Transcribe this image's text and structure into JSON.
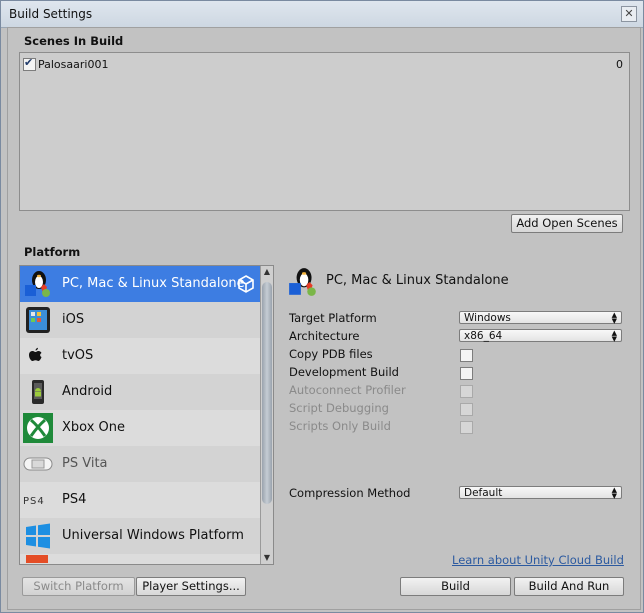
{
  "window": {
    "title": "Build Settings",
    "close_glyph": "✕"
  },
  "scenes": {
    "header": "Scenes In Build",
    "items": [
      {
        "name": "Palosaari001",
        "index": "0",
        "checked": true
      }
    ],
    "add_open_scenes_label": "Add Open Scenes"
  },
  "platform": {
    "header": "Platform",
    "items": [
      {
        "label": "PC, Mac & Linux Standalone",
        "icon": "pc-mac-linux-icon",
        "selected": true,
        "active": true
      },
      {
        "label": "iOS",
        "icon": "ios-icon"
      },
      {
        "label": "tvOS",
        "icon": "tvos-icon"
      },
      {
        "label": "Android",
        "icon": "android-icon"
      },
      {
        "label": "Xbox One",
        "icon": "xbox-icon"
      },
      {
        "label": "PS Vita",
        "icon": "psvita-icon"
      },
      {
        "label": "PS4",
        "icon": "ps4-icon"
      },
      {
        "label": "Universal Windows Platform",
        "icon": "windows-icon"
      }
    ]
  },
  "settings": {
    "title": "PC, Mac & Linux Standalone",
    "target_platform": {
      "label": "Target Platform",
      "value": "Windows"
    },
    "architecture": {
      "label": "Architecture",
      "value": "x86_64"
    },
    "copy_pdb": {
      "label": "Copy PDB files",
      "checked": false
    },
    "development_build": {
      "label": "Development Build",
      "checked": false
    },
    "autoconnect_profiler": {
      "label": "Autoconnect Profiler",
      "checked": false,
      "disabled": true
    },
    "script_debugging": {
      "label": "Script Debugging",
      "checked": false,
      "disabled": true
    },
    "scripts_only_build": {
      "label": "Scripts Only Build",
      "checked": false,
      "disabled": true
    },
    "compression": {
      "label": "Compression Method",
      "value": "Default"
    }
  },
  "footer": {
    "cloud_link": "Learn about Unity Cloud Build",
    "switch_platform": "Switch Platform",
    "player_settings": "Player Settings...",
    "build": "Build",
    "build_and_run": "Build And Run"
  },
  "colors": {
    "selection": "#3d7de2",
    "link": "#2c5aa0"
  }
}
